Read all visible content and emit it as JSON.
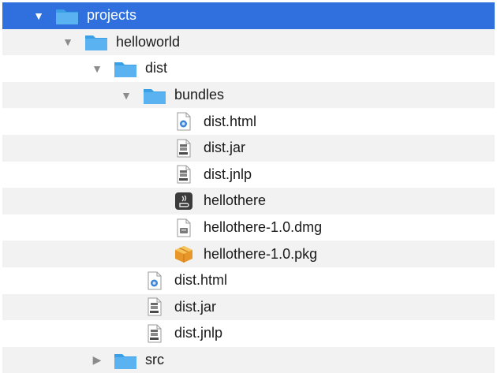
{
  "colors": {
    "selection": "#2f6fde",
    "stripe": "#f2f2f2",
    "folder": "#5ab3f0",
    "folder_tab": "#3b9fe6",
    "disclosure": "#8c8c8c"
  },
  "tree": [
    {
      "label": "projects",
      "depth": 0,
      "kind": "folder",
      "expanded": true,
      "icon": "folder-icon",
      "selected": true
    },
    {
      "label": "helloworld",
      "depth": 1,
      "kind": "folder",
      "expanded": true,
      "icon": "folder-icon"
    },
    {
      "label": "dist",
      "depth": 2,
      "kind": "folder",
      "expanded": true,
      "icon": "folder-icon"
    },
    {
      "label": "bundles",
      "depth": 3,
      "kind": "folder",
      "expanded": true,
      "icon": "folder-icon"
    },
    {
      "label": "dist.html",
      "depth": 4,
      "kind": "file",
      "icon": "html-file-icon"
    },
    {
      "label": "dist.jar",
      "depth": 4,
      "kind": "file",
      "icon": "jar-file-icon"
    },
    {
      "label": "dist.jnlp",
      "depth": 4,
      "kind": "file",
      "icon": "jnlp-file-icon"
    },
    {
      "label": "hellothere",
      "depth": 4,
      "kind": "file",
      "icon": "java-app-icon"
    },
    {
      "label": "hellothere-1.0.dmg",
      "depth": 4,
      "kind": "file",
      "icon": "dmg-file-icon"
    },
    {
      "label": "hellothere-1.0.pkg",
      "depth": 4,
      "kind": "file",
      "icon": "pkg-file-icon"
    },
    {
      "label": "dist.html",
      "depth": 3,
      "kind": "file",
      "icon": "html-file-icon"
    },
    {
      "label": "dist.jar",
      "depth": 3,
      "kind": "file",
      "icon": "jar-file-icon"
    },
    {
      "label": "dist.jnlp",
      "depth": 3,
      "kind": "file",
      "icon": "jnlp-file-icon"
    },
    {
      "label": "src",
      "depth": 2,
      "kind": "folder",
      "expanded": false,
      "icon": "folder-icon"
    }
  ]
}
